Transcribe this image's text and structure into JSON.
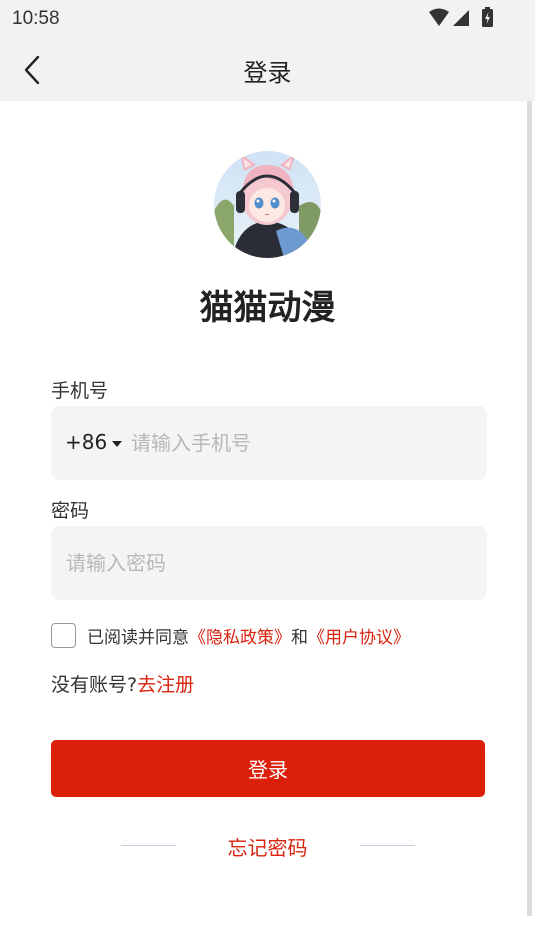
{
  "status_bar": {
    "time": "10:58",
    "icons": [
      "wifi-icon",
      "cell-signal-icon",
      "battery-charging-icon"
    ]
  },
  "header": {
    "back_icon": "chevron-left-icon",
    "title": "登录"
  },
  "app": {
    "name": "猫猫动漫",
    "avatar": "anime-girl-avatar"
  },
  "form": {
    "phone_label": "手机号",
    "country_code": "+86",
    "phone_placeholder": "请输入手机号",
    "phone_value": "",
    "password_label": "密码",
    "password_placeholder": "请输入密码",
    "password_value": ""
  },
  "agreement": {
    "checked": false,
    "prefix": "已阅读并同意",
    "privacy_link": "《隐私政策》",
    "and": "和",
    "user_link": "《用户协议》"
  },
  "register": {
    "prompt": "没有账号?",
    "link": "去注册"
  },
  "login_button": "登录",
  "forgot_password": "忘记密码",
  "colors": {
    "accent": "#dc1f0b",
    "input_bg": "#f3f4f6",
    "header_bg": "#f2f2f2"
  }
}
